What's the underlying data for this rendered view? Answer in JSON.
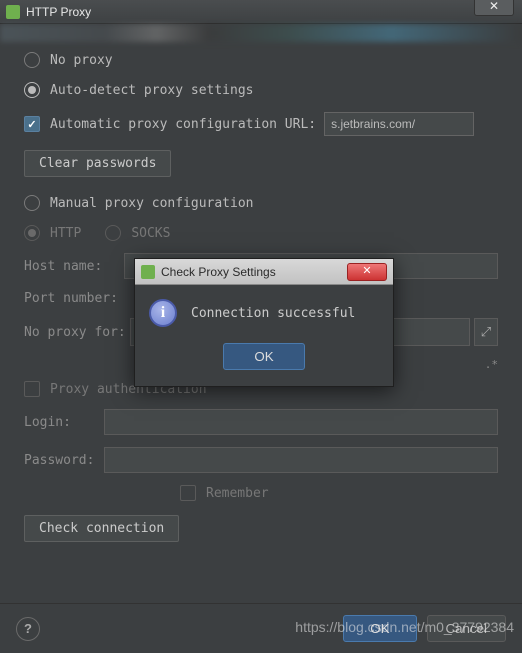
{
  "window": {
    "title": "HTTP Proxy"
  },
  "options": {
    "no_proxy": "No proxy",
    "auto_detect": "Auto-detect proxy settings",
    "manual": "Manual proxy configuration"
  },
  "auto": {
    "pac_checkbox_label": "Automatic proxy configuration URL:",
    "pac_url": "s.jetbrains.com/",
    "clear_passwords": "Clear passwords"
  },
  "manual": {
    "http": "HTTP",
    "socks": "SOCKS",
    "host_label": "Host name:",
    "host_value": "",
    "port_label": "Port number:",
    "no_proxy_label": "No proxy for:",
    "no_proxy_value": "",
    "hint": ".*",
    "auth_label": "Proxy authentication",
    "login_label": "Login:",
    "login_value": "",
    "password_label": "Password:",
    "password_value": "",
    "remember_label": "Remember"
  },
  "check_connection_btn": "Check connection",
  "footer": {
    "ok": "OK",
    "cancel": "Cancel"
  },
  "modal": {
    "title": "Check Proxy Settings",
    "message": "Connection successful",
    "ok": "OK"
  },
  "watermark": "https://blog.csdn.net/m0_37792384"
}
